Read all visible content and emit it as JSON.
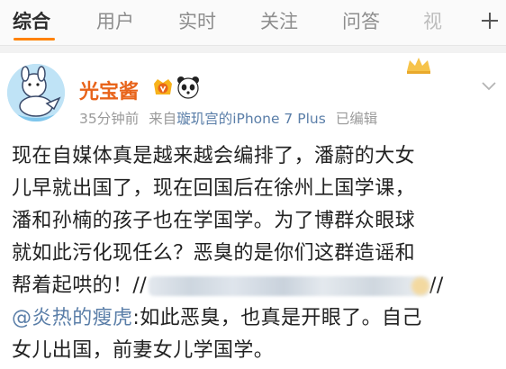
{
  "tabs": [
    {
      "label": "综合"
    },
    {
      "label": "用户"
    },
    {
      "label": "实时"
    },
    {
      "label": "关注"
    },
    {
      "label": "问答"
    },
    {
      "label": "视"
    }
  ],
  "post": {
    "author": "光宝酱",
    "time": "35分钟前",
    "source_prefix": "来自",
    "source_device": "璇玑宫的iPhone 7 Plus",
    "edited": "已编辑",
    "lines": [
      "现在自媒体真是越来越会编排了，潘蔚的大女",
      "儿早就出国了，现在回国后在徐州上国学课，",
      "潘和孙楠的孩子也在学国学。为了博群众眼球",
      "就如此污化现任么？恶臭的是你们这群造谣和"
    ],
    "line5_prefix": "帮着起哄的！//",
    "line5_suffix": "//",
    "mention": "@炎热的瘦虎",
    "line6_rest": ":如此恶臭，也真是开眼了。自己",
    "line7": "女儿出国，前妻女儿学国学。"
  },
  "colors": {
    "accent": "#ff8200",
    "username": "#e8641b",
    "link": "#5a7ea8"
  },
  "icons": [
    "plus-icon",
    "vip-badge-icon",
    "panda-icon",
    "crown-icon",
    "chevron-down-icon"
  ]
}
